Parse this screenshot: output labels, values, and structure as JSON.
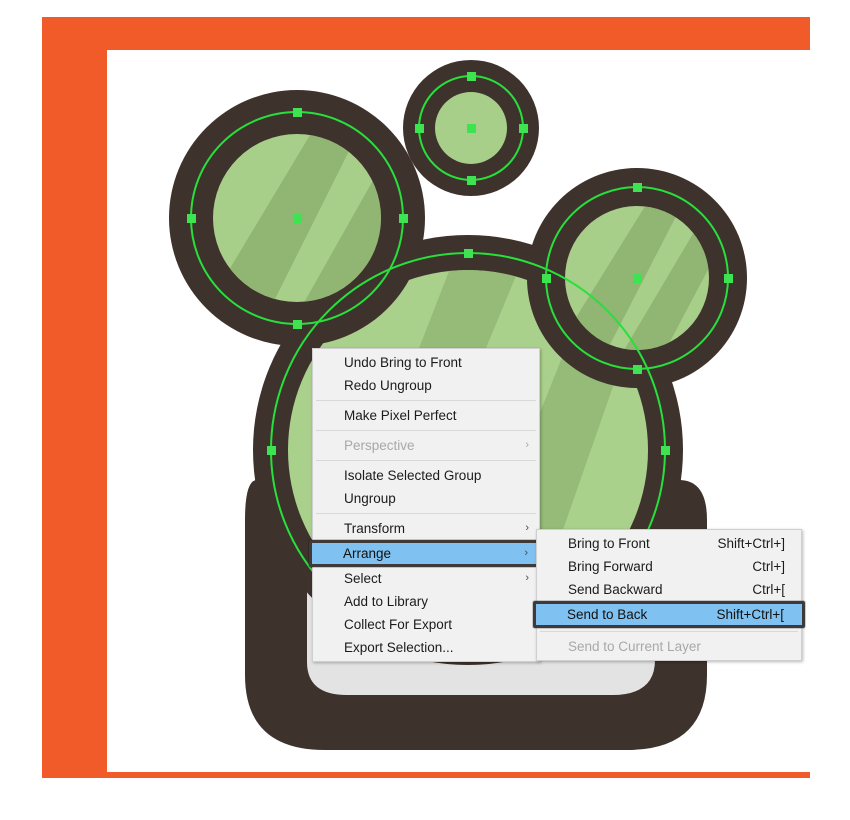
{
  "app": {
    "artboard": {
      "frame_color": "#f15a29",
      "canvas_color": "#ffffff"
    },
    "artwork": {
      "name": "frog-mascot-vector",
      "outline_color": "#3e322c",
      "body_light_green": "#aad18c",
      "body_mid_green": "#8fb373",
      "eye_green": "#a8cf8a",
      "eye_shade_green": "#8db06f",
      "mouth_gray": "#e3e3e3",
      "path_stroke": "#28e03c",
      "anchor_color": "#3ee352"
    }
  },
  "context_menu": {
    "name": "canvas-context-menu",
    "items": [
      {
        "id": "undo-bring-to-front",
        "label": "Undo Bring to Front",
        "accel": "",
        "submenu": false,
        "disabled": false,
        "highlight": false
      },
      {
        "id": "redo-ungroup",
        "label": "Redo Ungroup",
        "accel": "",
        "submenu": false,
        "disabled": false,
        "highlight": false
      },
      {
        "id": "separator-1",
        "separator": true
      },
      {
        "id": "make-pixel-perfect",
        "label": "Make Pixel Perfect",
        "accel": "",
        "submenu": false,
        "disabled": false,
        "highlight": false
      },
      {
        "id": "separator-2",
        "separator": true
      },
      {
        "id": "perspective",
        "label": "Perspective",
        "accel": "",
        "submenu": true,
        "disabled": true,
        "highlight": false
      },
      {
        "id": "separator-3",
        "separator": true
      },
      {
        "id": "isolate-selected-group",
        "label": "Isolate Selected Group",
        "accel": "",
        "submenu": false,
        "disabled": false,
        "highlight": false
      },
      {
        "id": "ungroup",
        "label": "Ungroup",
        "accel": "",
        "submenu": false,
        "disabled": false,
        "highlight": false
      },
      {
        "id": "separator-4",
        "separator": true
      },
      {
        "id": "transform",
        "label": "Transform",
        "accel": "",
        "submenu": true,
        "disabled": false,
        "highlight": false
      },
      {
        "id": "arrange",
        "label": "Arrange",
        "accel": "",
        "submenu": true,
        "disabled": false,
        "highlight": true
      },
      {
        "id": "select",
        "label": "Select",
        "accel": "",
        "submenu": true,
        "disabled": false,
        "highlight": false
      },
      {
        "id": "add-to-library",
        "label": "Add to Library",
        "accel": "",
        "submenu": false,
        "disabled": false,
        "highlight": false
      },
      {
        "id": "collect-for-export",
        "label": "Collect For Export",
        "accel": "",
        "submenu": false,
        "disabled": false,
        "highlight": false
      },
      {
        "id": "export-selection",
        "label": "Export Selection...",
        "accel": "",
        "submenu": false,
        "disabled": false,
        "highlight": false
      }
    ]
  },
  "submenu": {
    "name": "arrange-submenu",
    "parent": "Arrange",
    "items": [
      {
        "id": "bring-to-front",
        "label": "Bring to Front",
        "accel": "Shift+Ctrl+]",
        "disabled": false,
        "highlight": false
      },
      {
        "id": "bring-forward",
        "label": "Bring Forward",
        "accel": "Ctrl+]",
        "disabled": false,
        "highlight": false
      },
      {
        "id": "send-backward",
        "label": "Send Backward",
        "accel": "Ctrl+[",
        "disabled": false,
        "highlight": false
      },
      {
        "id": "send-to-back",
        "label": "Send to Back",
        "accel": "Shift+Ctrl+[",
        "disabled": false,
        "highlight": true
      },
      {
        "id": "separator-sub-1",
        "separator": true
      },
      {
        "id": "send-to-current-layer",
        "label": "Send to Current Layer",
        "accel": "",
        "disabled": true,
        "highlight": false
      }
    ]
  },
  "submenu_arrow_glyph": "›"
}
